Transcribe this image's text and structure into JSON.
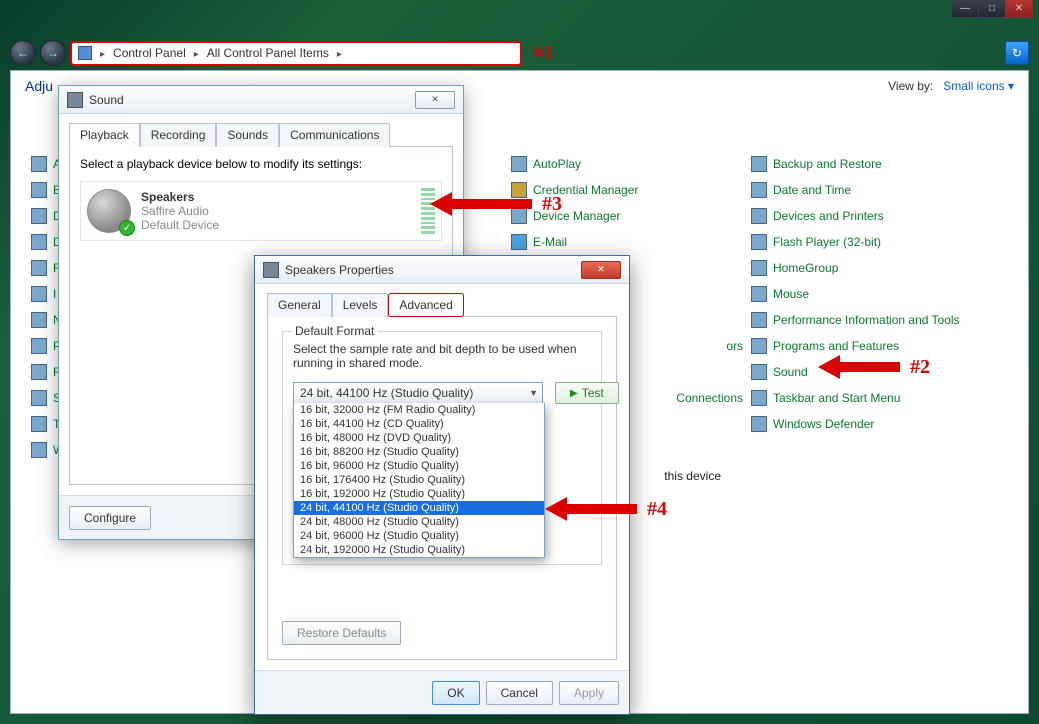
{
  "window": {
    "minimize": "—",
    "maximize": "□",
    "close": "✕"
  },
  "breadcrumb": {
    "item1": "Control Panel",
    "item2": "All Control Panel Items"
  },
  "annotations": {
    "a1": "#1",
    "a2": "#2",
    "a3": "#3",
    "a4": "#4"
  },
  "cp": {
    "title_prefix": "Adju",
    "viewby_label": "View by:",
    "viewby_value": "Small icons ▾"
  },
  "col1": [
    "A",
    "B",
    "D",
    "D",
    "F",
    "I",
    "N",
    "P",
    "R",
    "S",
    "T",
    "W"
  ],
  "col3": {
    "items": [
      "AutoPlay",
      "Credential Manager",
      "Device Manager",
      "E-Mail"
    ],
    "partial1": "ors",
    "partial2": "Connections",
    "partial3": "this device"
  },
  "col4_items": [
    "Backup and Restore",
    "Date and Time",
    "Devices and Printers",
    "Flash Player (32-bit)",
    "HomeGroup",
    "Mouse",
    "Performance Information and Tools",
    "Programs and Features",
    "Sound",
    "Taskbar and Start Menu",
    "Windows Defender"
  ],
  "sound_dlg": {
    "title": "Sound",
    "tabs": [
      "Playback",
      "Recording",
      "Sounds",
      "Communications"
    ],
    "instruction": "Select a playback device below to modify its settings:",
    "device_name": "Speakers",
    "device_line1": "Saffire Audio",
    "device_line2": "Default Device",
    "configure": "Configure"
  },
  "props_dlg": {
    "title": "Speakers Properties",
    "tabs": [
      "General",
      "Levels",
      "Advanced"
    ],
    "fieldset_legend": "Default Format",
    "fieldset_text": "Select the sample rate and bit depth to be used when running in shared mode.",
    "combo_value": "24 bit, 44100 Hz (Studio Quality)",
    "test": "Test",
    "options": [
      "16 bit, 32000 Hz (FM Radio Quality)",
      "16 bit, 44100 Hz (CD Quality)",
      "16 bit, 48000 Hz (DVD Quality)",
      "16 bit, 88200 Hz (Studio Quality)",
      "16 bit, 96000 Hz (Studio Quality)",
      "16 bit, 176400 Hz (Studio Quality)",
      "16 bit, 192000 Hz (Studio Quality)",
      "24 bit, 44100 Hz (Studio Quality)",
      "24 bit, 48000 Hz (Studio Quality)",
      "24 bit, 96000 Hz (Studio Quality)",
      "24 bit, 192000 Hz (Studio Quality)"
    ],
    "selected_index": 7,
    "restore": "Restore Defaults",
    "ok": "OK",
    "cancel": "Cancel",
    "apply": "Apply"
  }
}
